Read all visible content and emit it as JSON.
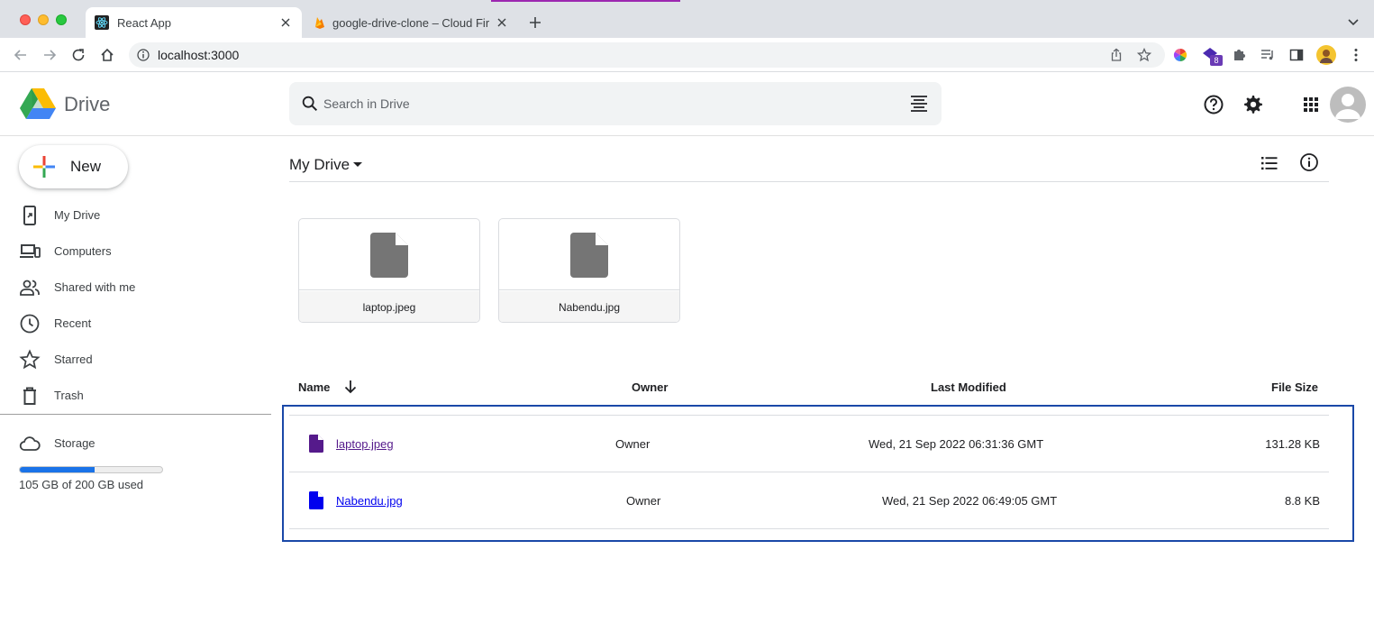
{
  "browser": {
    "tabs": [
      {
        "title": "React App",
        "icon": "react-icon",
        "active": true
      },
      {
        "title": "google-drive-clone – Cloud Fir",
        "icon": "firebase-icon",
        "active": false
      }
    ],
    "url": "localhost:3000"
  },
  "header": {
    "app_name": "Drive",
    "search_placeholder": "Search in Drive"
  },
  "sidebar": {
    "new_label": "New",
    "items": [
      {
        "label": "My Drive",
        "icon": "my-drive-icon"
      },
      {
        "label": "Computers",
        "icon": "computers-icon"
      },
      {
        "label": "Shared with me",
        "icon": "shared-icon"
      },
      {
        "label": "Recent",
        "icon": "clock-icon"
      },
      {
        "label": "Starred",
        "icon": "star-icon"
      },
      {
        "label": "Trash",
        "icon": "trash-icon"
      }
    ],
    "storage": {
      "label": "Storage",
      "used_fraction": 0.525,
      "text": "105 GB of 200 GB used"
    }
  },
  "main": {
    "title": "My Drive",
    "cards": [
      {
        "name": "laptop.jpeg"
      },
      {
        "name": "Nabendu.jpg"
      }
    ],
    "columns": {
      "name": "Name",
      "owner": "Owner",
      "modified": "Last Modified",
      "size": "File Size"
    },
    "rows": [
      {
        "name": "laptop.jpeg",
        "owner": "Owner",
        "modified": "Wed, 21 Sep 2022 06:31:36 GMT",
        "size": "131.28 KB",
        "link_color": "#551a8b"
      },
      {
        "name": "Nabendu.jpg",
        "owner": "Owner",
        "modified": "Wed, 21 Sep 2022 06:49:05 GMT",
        "size": "8.8 KB",
        "link_color": "#0000ee"
      }
    ]
  },
  "colors": {
    "accent": "#1a73e8",
    "focus_border": "#1a48a8"
  }
}
